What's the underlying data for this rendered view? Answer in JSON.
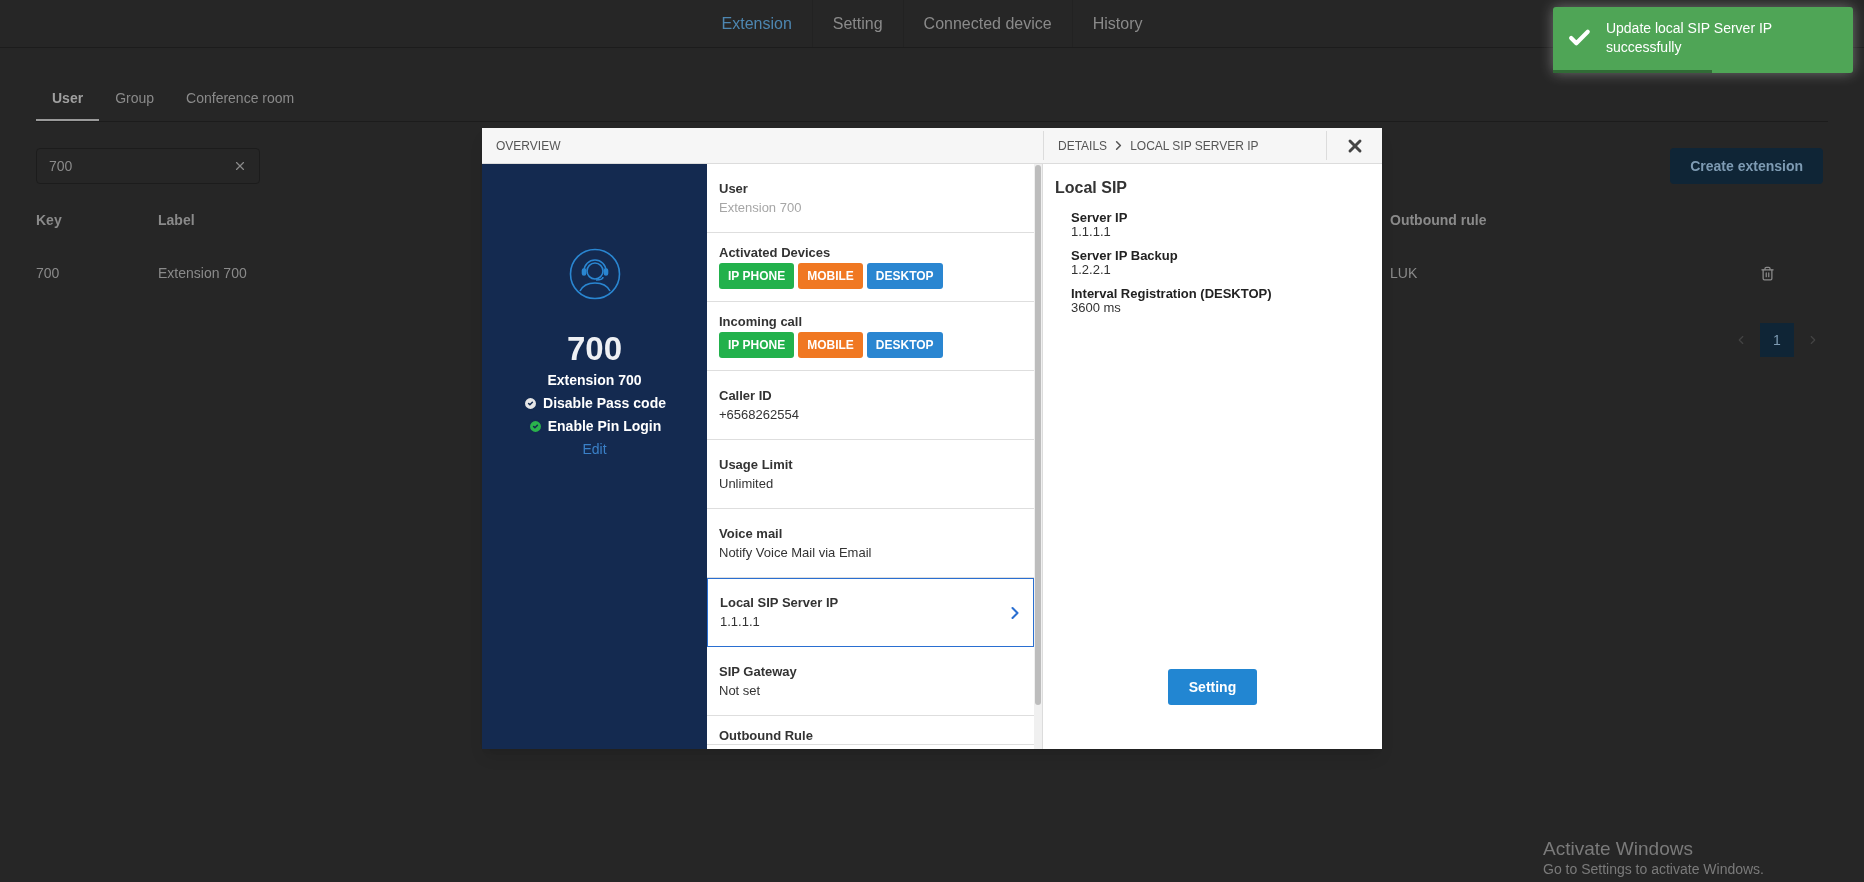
{
  "nav_tabs": [
    {
      "label": "Extension",
      "selected": true
    },
    {
      "label": "Setting",
      "selected": false
    },
    {
      "label": "Connected device",
      "selected": false
    },
    {
      "label": "History",
      "selected": false
    }
  ],
  "sub_tabs": [
    {
      "label": "User",
      "selected": true
    },
    {
      "label": "Group",
      "selected": false
    },
    {
      "label": "Conference room",
      "selected": false
    }
  ],
  "search": {
    "value": "700"
  },
  "create_button": "Create extension",
  "table": {
    "columns": [
      "Key",
      "Label",
      "Outbound rule"
    ],
    "rows": [
      {
        "key": "700",
        "label": "Extension 700",
        "outbound_rule": "LUK"
      }
    ]
  },
  "pagination": {
    "pages": [
      {
        "label": "1",
        "selected": true
      }
    ]
  },
  "modal": {
    "overview_title": "OVERVIEW",
    "breadcrumb": [
      "DETAILS",
      "LOCAL SIP SERVER IP"
    ],
    "profile": {
      "number": "700",
      "name": "Extension 700",
      "flags": [
        {
          "label": "Disable Pass code",
          "color": "#e6e6e6"
        },
        {
          "label": "Enable Pin Login",
          "color": "#2ab24c"
        }
      ],
      "edit_link": "Edit"
    },
    "items": [
      {
        "kind": "text",
        "label": "User",
        "value": "Extension 700",
        "muted": true,
        "selected": false
      },
      {
        "kind": "devices",
        "label": "Activated Devices",
        "devices": [
          {
            "label": "IP PHONE",
            "color": "#22b14c"
          },
          {
            "label": "MOBILE",
            "color": "#f07822"
          },
          {
            "label": "DESKTOP",
            "color": "#2a86d1"
          }
        ],
        "selected": false
      },
      {
        "kind": "devices",
        "label": "Incoming call",
        "devices": [
          {
            "label": "IP PHONE",
            "color": "#22b14c"
          },
          {
            "label": "MOBILE",
            "color": "#f07822"
          },
          {
            "label": "DESKTOP",
            "color": "#2a86d1"
          }
        ],
        "selected": false
      },
      {
        "kind": "text",
        "label": "Caller ID",
        "value": "+6568262554",
        "muted": false,
        "selected": false
      },
      {
        "kind": "text",
        "label": "Usage Limit",
        "value": "Unlimited",
        "muted": false,
        "selected": false
      },
      {
        "kind": "text",
        "label": "Voice mail",
        "value": "Notify Voice Mail via Email",
        "muted": false,
        "selected": false
      },
      {
        "kind": "text",
        "label": "Local SIP Server IP",
        "value": "1.1.1.1",
        "muted": false,
        "selected": true
      },
      {
        "kind": "text",
        "label": "SIP Gateway",
        "value": "Not set",
        "muted": false,
        "selected": false
      },
      {
        "kind": "text",
        "label": "Outbound Rule",
        "selected": false
      }
    ],
    "details": {
      "title": "Local SIP",
      "fields": [
        {
          "label": "Server IP",
          "value": "1.1.1.1"
        },
        {
          "label": "Server IP Backup",
          "value": "1.2.2.1"
        },
        {
          "label": "Interval Registration (DESKTOP)",
          "value": "3600 ms"
        }
      ],
      "button": "Setting"
    }
  },
  "toast": {
    "message": "Update local SIP Server IP successfully",
    "level": 0.53
  },
  "os_notice": {
    "title": "Activate Windows",
    "text": "Go to Settings to activate Windows."
  }
}
